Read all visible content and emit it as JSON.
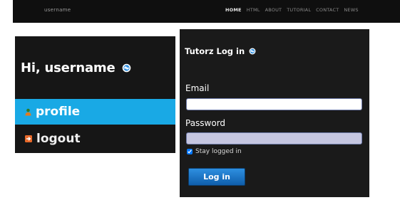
{
  "topbar": {
    "brand": "username",
    "nav": [
      {
        "label": "home",
        "active": true
      },
      {
        "label": "html",
        "active": false
      },
      {
        "label": "about",
        "active": false
      },
      {
        "label": "tutorial",
        "active": false
      },
      {
        "label": "contact",
        "active": false
      },
      {
        "label": "news",
        "active": false
      }
    ]
  },
  "user_panel": {
    "greeting": "Hi, username",
    "greeting_icon": "globe-icon",
    "items": [
      {
        "label": "profile",
        "icon": "user-icon",
        "active": true
      },
      {
        "label": "logout",
        "icon": "arrow-right-icon",
        "active": false
      }
    ]
  },
  "login": {
    "title": "Tutorz Log in",
    "title_icon": "globe-icon",
    "email_label": "Email",
    "email_value": "",
    "password_label": "Password",
    "password_value": "",
    "stay_logged_in_label": "Stay logged in",
    "stay_logged_in_checked": true,
    "submit_label": "Log in"
  },
  "colors": {
    "accent": "#19a9e5",
    "panel_bg": "#161616",
    "button": "#1a6fc2",
    "logout_icon": "#e8692a",
    "profile_icon": "#3d8a2a"
  }
}
